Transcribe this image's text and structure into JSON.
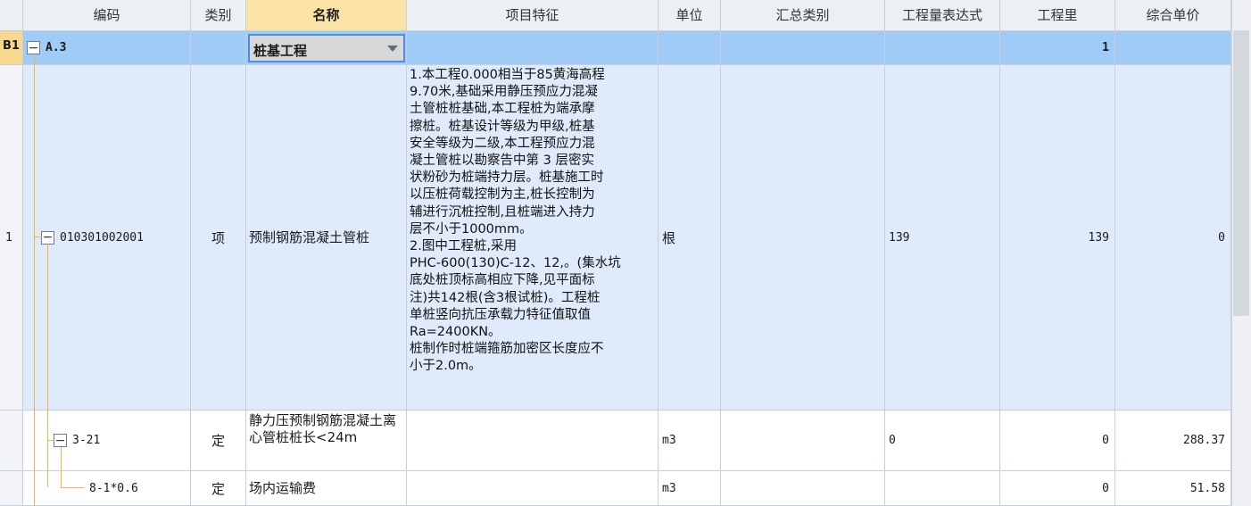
{
  "columns": [
    "编码",
    "类别",
    "名称",
    "项目特征",
    "单位",
    "汇总类别",
    "工程量表达式",
    "工程里",
    "综合单价"
  ],
  "rows": {
    "section": {
      "rownum": "B1",
      "code": "A.3",
      "name": "桩基工程",
      "qty": "1"
    },
    "item": {
      "rownum": "1",
      "code": "010301002001",
      "type": "项",
      "name": "预制钢筋混凝土管桩",
      "feature": "1.本工程0.000相当于85黄海高程\n9.70米,基础采用静压预应力混凝\n土管桩桩基础,本工程桩为端承摩\n擦桩。桩基设计等级为甲级,桩基\n安全等级为二级,本工程预应力混\n凝土管桩以勘察告中第 3  层密实\n状粉砂为桩端持力层。桩基施工时\n以压桩荷载控制为主,桩长控制为\n辅进行沉桩控制,且桩端进入持力\n层不小于1000mm。\n2.图中工程桩,采用\nPHC-600(130)C-12、12,。(集水坑\n底处桩顶标高相应下降,见平面标\n注)共142根(含3根试桩)。工程桩\n单桩竖向抗压承载力特征值取值\nRa=2400KN。\n桩制作时桩端箍筋加密区长度应不\n小于2.0m。",
      "unit": "根",
      "expr": "139",
      "qty": "139",
      "price": "0"
    },
    "sub1": {
      "code": "3-21",
      "type": "定",
      "name": "静力压预制钢筋混凝土离心管桩桩长<24m",
      "unit": "m3",
      "expr": "0",
      "qty": "0",
      "price": "288.37"
    },
    "sub2": {
      "code": "8-1*0.6",
      "type": "定",
      "name": "场内运输费",
      "unit": "m3",
      "qty": "0",
      "price": "51.58"
    }
  },
  "colors": {
    "header_bg": "#eceff3",
    "active_header": "#fbe3a8",
    "selected_row": "#9fcbf6",
    "row_bg": "#dfeafb",
    "tree_line": "#f0b24a",
    "combo_border": "#4a8fe0"
  },
  "icons": {
    "expand": "minus-box-icon",
    "dropdown": "triangle-down-icon"
  }
}
